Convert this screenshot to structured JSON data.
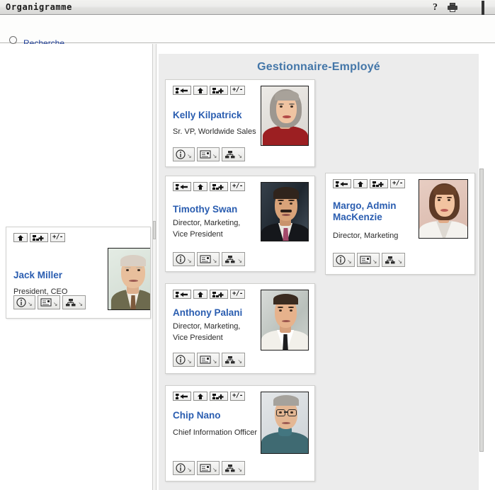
{
  "window": {
    "title": "Organigramme",
    "controls": [
      {
        "name": "help-button",
        "glyph": "?"
      },
      {
        "name": "print-button",
        "glyph": "printer"
      },
      {
        "name": "minimize-button",
        "glyph": "_"
      },
      {
        "name": "maximize-button",
        "glyph": "□"
      }
    ]
  },
  "toolbar": {
    "search_label": "Recherche",
    "search_icon": "magnifier-icon"
  },
  "board": {
    "title": "Gestionnaire-Employé",
    "title_color": "#4376a8"
  },
  "icons": {
    "up": "up-arrow-icon",
    "manager": "go-to-manager-icon",
    "expand_org": "expand-org-icon",
    "plus_minus": "+/-",
    "info": "info-icon",
    "card": "business-card-icon",
    "org": "org-chart-icon",
    "caret": "↘"
  },
  "cards": [
    {
      "id": "jack-miller",
      "name": "Jack Miller",
      "title": "President, CEO",
      "has_manager_button": false,
      "name_lines": 1,
      "title_lines": 1
    },
    {
      "id": "kelly-kilpatrick",
      "name": "Kelly Kilpatrick",
      "title": "Sr. VP, Worldwide Sales",
      "has_manager_button": true,
      "name_lines": 1,
      "title_lines": 1
    },
    {
      "id": "timothy-swan",
      "name": "Timothy Swan",
      "title": "Director, Marketing, Vice President",
      "has_manager_button": true,
      "name_lines": 1,
      "title_lines": 2
    },
    {
      "id": "margo-admin-mackenzie",
      "name": "Margo, Admin MacKenzie",
      "title": "Director, Marketing",
      "has_manager_button": true,
      "name_lines": 2,
      "title_lines": 1
    },
    {
      "id": "anthony-palani",
      "name": "Anthony Palani",
      "title": "Director, Marketing, Vice President",
      "has_manager_button": true,
      "name_lines": 1,
      "title_lines": 2
    },
    {
      "id": "chip-nano",
      "name": "Chip Nano",
      "title": "Chief Information Officer",
      "has_manager_button": true,
      "name_lines": 1,
      "title_lines": 1
    }
  ]
}
